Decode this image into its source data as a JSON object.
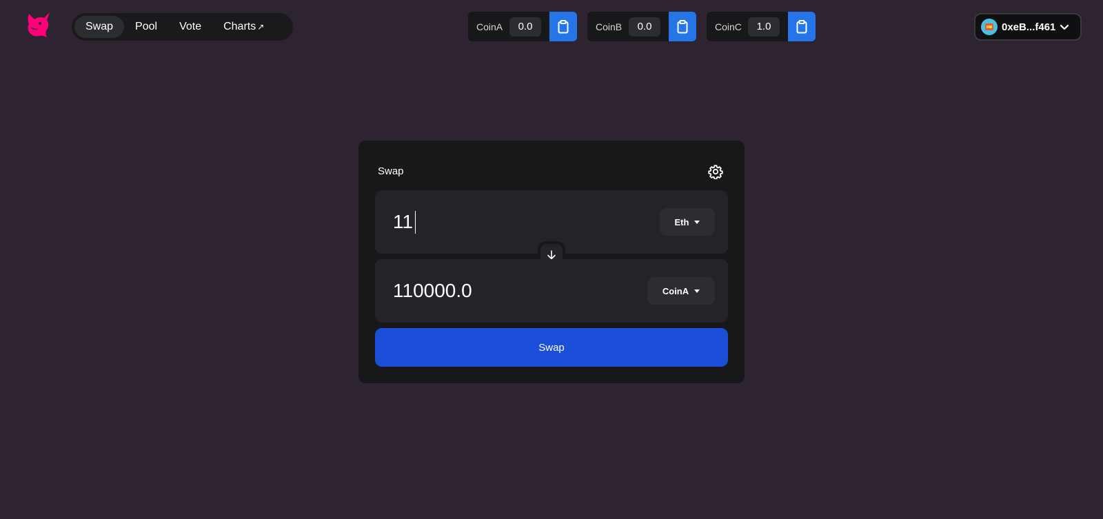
{
  "nav": {
    "items": [
      {
        "label": "Swap",
        "active": true
      },
      {
        "label": "Pool",
        "active": false
      },
      {
        "label": "Vote",
        "active": false
      },
      {
        "label": "Charts",
        "active": false,
        "external": "↗"
      }
    ]
  },
  "balances": [
    {
      "coin": "CoinA",
      "value": "0.0",
      "icon": "clipboard-icon"
    },
    {
      "coin": "CoinB",
      "value": "0.0",
      "icon": "clipboard-icon"
    },
    {
      "coin": "CoinC",
      "value": "1.0",
      "icon": "clipboard-icon"
    }
  ],
  "wallet": {
    "address": "0xeB...f461",
    "icon": "chevron-down-icon"
  },
  "swap": {
    "title": "Swap",
    "settings_icon": "gear-icon",
    "from": {
      "amount": "11",
      "token": "Eth"
    },
    "to": {
      "amount": "110000.0",
      "token": "CoinA"
    },
    "direction_icon": "arrow-down-icon",
    "button_label": "Swap"
  },
  "colors": {
    "background": "#2e2331",
    "card": "#18181a",
    "panel": "#222427",
    "accent_blue": "#1c4fd9",
    "copy_blue": "#2575e6",
    "logo_pink": "#ff007a"
  }
}
